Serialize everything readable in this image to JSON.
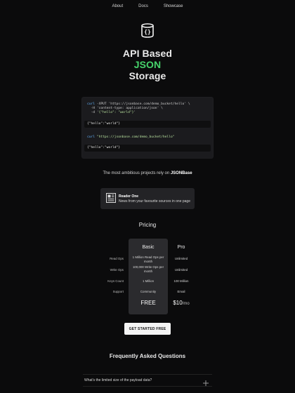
{
  "nav": {
    "items": [
      {
        "label": "About"
      },
      {
        "label": "Docs"
      },
      {
        "label": "Showcase"
      }
    ]
  },
  "hero": {
    "title_line1": "API Based",
    "title_line2": "JSON",
    "title_line3": "Storage"
  },
  "code": {
    "cmd1": {
      "line1_kw": "curl",
      "line1_rest": " -XPUT 'https://jsonbase.com/demo_bucket/hello' \\",
      "line2": "  -H 'content-type: application/json' \\",
      "line3_prefix": "  -d '",
      "line3_str": "{\"hello\": \"world\"}",
      "line3_suffix": "'"
    },
    "output1": "{\"hello\":\"world\"}",
    "cmd2": {
      "kw": "curl",
      "rest": " \"https://jsonbase.com/demo_bucket/hello\""
    },
    "output2": "{\"hello\":\"world\"}"
  },
  "rely": {
    "text": "The most ambitious projects rely on ",
    "brand": "JSONBase"
  },
  "project": {
    "name": "Reader One",
    "description": "News from your favourite sources in one page",
    "icon": "newspaper-icon"
  },
  "pricing": {
    "title": "Pricing",
    "plans": [
      {
        "name": "Basic",
        "price": "FREE"
      },
      {
        "name": "Pro",
        "price_amount": "$10",
        "price_unit": "/mo"
      }
    ],
    "rows": [
      {
        "label": "Read Ops",
        "basic": "1 Million Read Ops per month",
        "pro": "Unlimited"
      },
      {
        "label": "Write Ops",
        "basic": "100,000 Write Ops per month",
        "pro": "Unlimited"
      },
      {
        "label": "Keys Count",
        "basic": "1 Million",
        "pro": "100 Million"
      },
      {
        "label": "Support",
        "basic": "Community",
        "pro": "Email"
      }
    ]
  },
  "cta": {
    "label": "GET STARTED FREE"
  },
  "faq": {
    "title": "Frequently Asked Questions",
    "items": [
      {
        "question": "What's the limited size of the payload data?"
      }
    ]
  },
  "colors": {
    "background": "#0b0b0c",
    "accent": "#46d36b",
    "card": "#1b1b1e"
  }
}
